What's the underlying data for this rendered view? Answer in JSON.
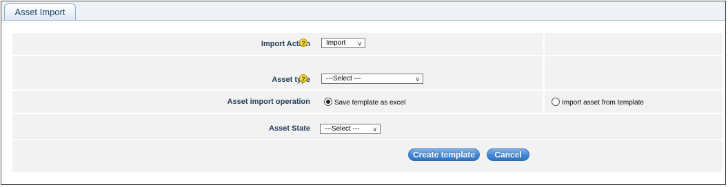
{
  "tab": {
    "title": "Asset Import"
  },
  "form": {
    "import_action": {
      "label": "Import Action",
      "value": "Import"
    },
    "asset_type": {
      "label": "Asset type",
      "value": "---Select ---"
    },
    "import_operation": {
      "label": "Asset import operation",
      "options": [
        {
          "label": "Save template as excel",
          "selected": true
        },
        {
          "label": "Import asset from template",
          "selected": false
        }
      ]
    },
    "asset_state": {
      "label": "Asset State",
      "value": "---Select ---"
    }
  },
  "buttons": {
    "create_template": "Create template",
    "cancel": "Cancel"
  },
  "icons": {
    "help": "help-icon",
    "dropdown": "chevron-down-icon"
  },
  "colors": {
    "label_text": "#1f3a57",
    "button_blue": "#3f86d6",
    "help_yellow": "#e8c400"
  }
}
